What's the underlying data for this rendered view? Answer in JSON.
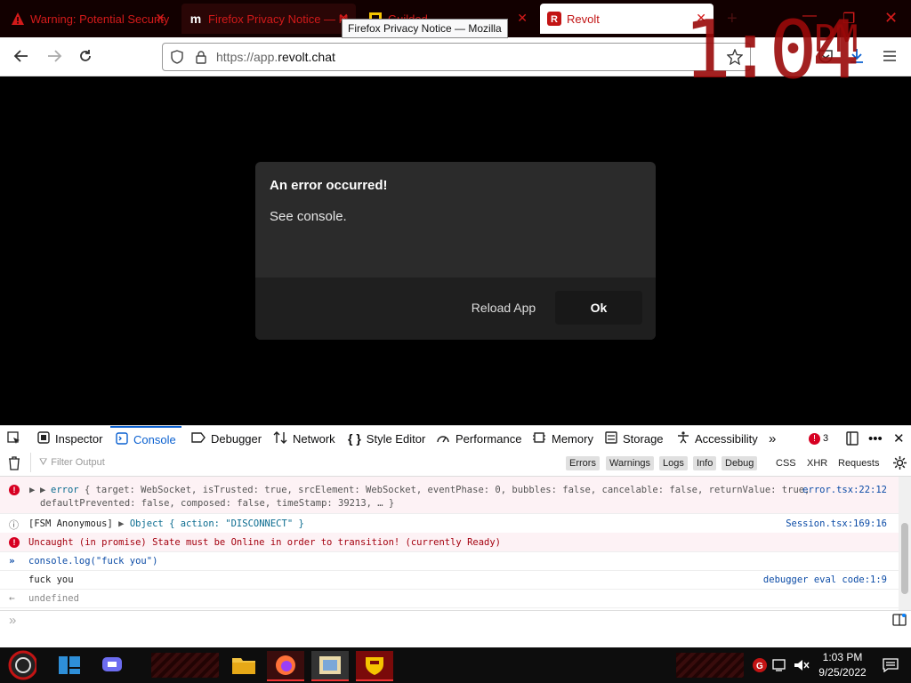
{
  "browser": {
    "tabs": [
      {
        "title": "Warning: Potential Security",
        "close": "✕",
        "active": false
      },
      {
        "title": "Firefox Privacy Notice — M",
        "close": "✕",
        "active": false
      },
      {
        "title": "Guilded",
        "close": "✕",
        "active": false
      },
      {
        "title": "Revolt",
        "close": "✕",
        "active": true
      }
    ],
    "new_tab": "+",
    "tooltip": "Firefox Privacy Notice — Mozilla",
    "window_controls": {
      "minimize": "—",
      "maximize": "❐",
      "close": "✕"
    },
    "url_prefix": "https://app.",
    "url_domain": "revolt.chat"
  },
  "overlay_clock": {
    "time": "1:04",
    "ampm": "PM"
  },
  "modal": {
    "title": "An error occurred!",
    "body": "See console.",
    "reload_label": "Reload App",
    "ok_label": "Ok"
  },
  "devtools": {
    "tabs": [
      {
        "label": "Inspector",
        "icon": "inspector-icon"
      },
      {
        "label": "Console",
        "icon": "console-icon"
      },
      {
        "label": "Debugger",
        "icon": "debugger-icon"
      },
      {
        "label": "Network",
        "icon": "network-icon"
      },
      {
        "label": "Style Editor",
        "icon": "style-editor-icon"
      },
      {
        "label": "Performance",
        "icon": "performance-icon"
      },
      {
        "label": "Memory",
        "icon": "memory-icon"
      },
      {
        "label": "Storage",
        "icon": "storage-icon"
      },
      {
        "label": "Accessibility",
        "icon": "accessibility-icon"
      }
    ],
    "selected_tab": "Console",
    "error_count": "3",
    "filter_placeholder": "Filter Output",
    "filter_buttons": [
      "Errors",
      "Warnings",
      "Logs",
      "Info",
      "Debug"
    ],
    "filter_buttons_right": [
      "CSS",
      "XHR",
      "Requests"
    ]
  },
  "console": {
    "row1": {
      "label": "error",
      "line1": "{ target: WebSocket, isTrusted: true, srcElement: WebSocket, eventPhase: 0, bubbles: false, cancelable: false, returnValue: true,",
      "line2": "defaultPrevented: false, composed: false, timeStamp: 39213, … }",
      "source": "error.tsx:22:12"
    },
    "row2": {
      "prefix": "[FSM Anonymous]",
      "object": "Object { action: \"DISCONNECT\" }",
      "source": "Session.tsx:169:16"
    },
    "row3": {
      "text": "Uncaught (in promise) State must be Online in order to transition! (currently Ready)"
    },
    "row4": {
      "text": "console.log(\"fuck you\")"
    },
    "row5": {
      "text": "fuck you",
      "source": "debugger eval code:1:9"
    },
    "row6": {
      "text": "undefined"
    }
  },
  "taskbar": {
    "time": "1:03 PM",
    "date": "9/25/2022"
  }
}
